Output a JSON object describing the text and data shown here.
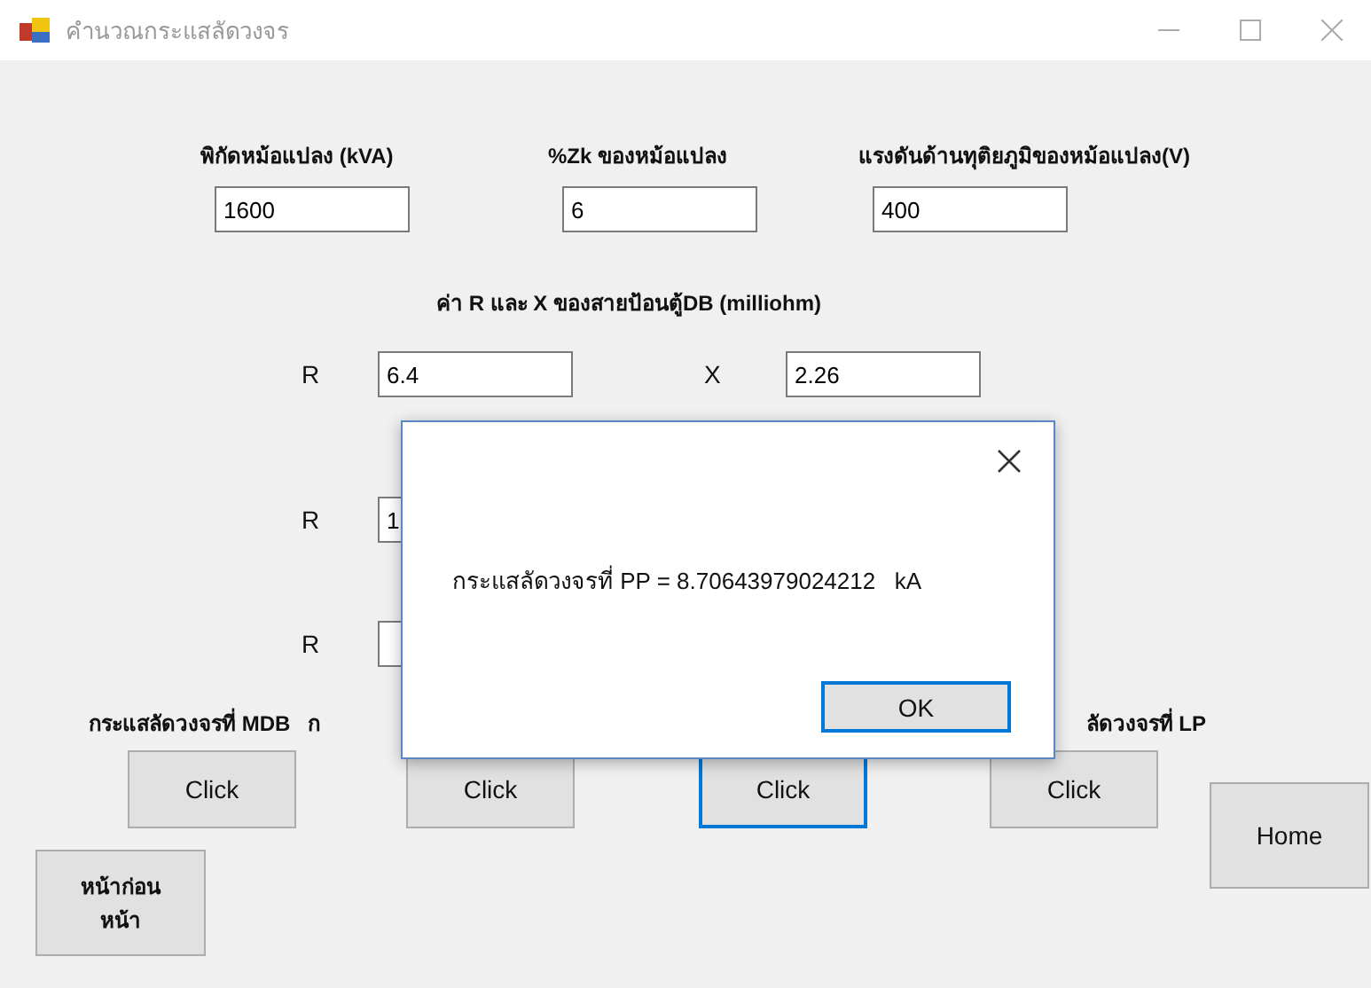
{
  "window": {
    "title": "คำนวณกระแสลัดวงจร"
  },
  "transformer": [
    {
      "label": "พิกัดหม้อแปลง (kVA)",
      "value": "1600"
    },
    {
      "label": "%Zk ของหม้อแปลง",
      "value": "6"
    },
    {
      "label": "แรงดันด้านทุติยภูมิของหม้อแปลง(V)",
      "value": "400"
    }
  ],
  "feeder_heading": "ค่า R และ X ของสายป้อนตู้DB (milliohm)",
  "rx_rows": [
    {
      "r_label": "R",
      "r_value": "6.4",
      "x_label": "X",
      "x_value": "2.26"
    },
    {
      "r_label": "R",
      "r_value": "1"
    },
    {
      "r_label": "R",
      "r_value": ""
    }
  ],
  "result_labels": [
    "กระแสลัดวงจรที่ MDB",
    "ก",
    "ลัดวงจรที่ LP"
  ],
  "click_buttons": [
    {
      "label": "Click",
      "selected": false
    },
    {
      "label": "Click",
      "selected": false
    },
    {
      "label": "Click",
      "selected": true
    },
    {
      "label": "Click",
      "selected": false
    }
  ],
  "home_button": "Home",
  "back_button": "หน้าก่อน\nหน้า",
  "dialog": {
    "message": "กระแสลัดวงจรที่ PP = 8.70643979024212   kA",
    "ok_button": "OK"
  }
}
